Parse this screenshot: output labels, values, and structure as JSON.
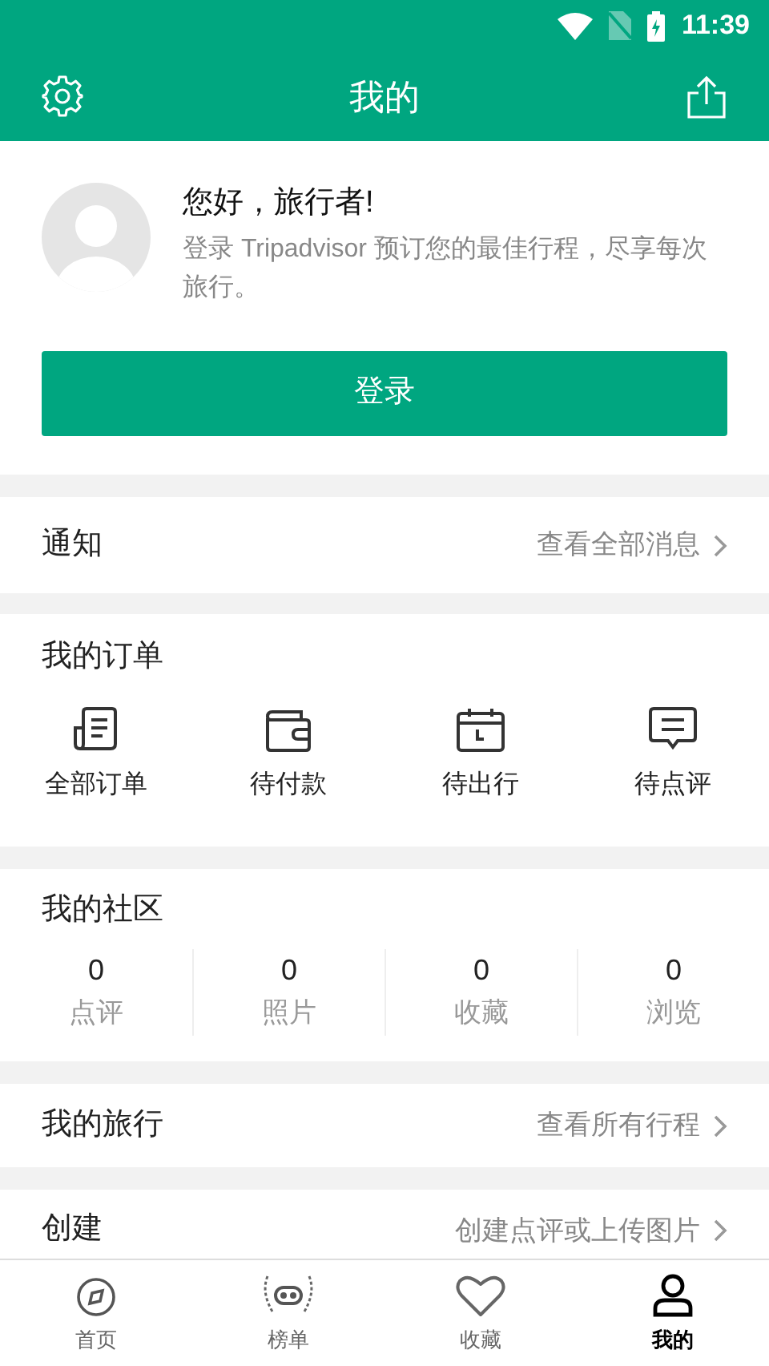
{
  "status_bar": {
    "time": "11:39"
  },
  "header": {
    "title": "我的"
  },
  "profile": {
    "greeting": "您好，旅行者!",
    "subtitle": "登录 Tripadvisor 预订您的最佳行程，尽享每次旅行。",
    "login_button": "登录"
  },
  "notifications": {
    "label": "通知",
    "link": "查看全部消息"
  },
  "orders": {
    "title": "我的订单",
    "items": [
      {
        "kind": "all",
        "label": "全部订单"
      },
      {
        "kind": "payment",
        "label": "待付款"
      },
      {
        "kind": "departure",
        "label": "待出行"
      },
      {
        "kind": "review",
        "label": "待点评"
      }
    ]
  },
  "community": {
    "title": "我的社区",
    "stats": [
      {
        "count": "0",
        "label": "点评"
      },
      {
        "count": "0",
        "label": "照片"
      },
      {
        "count": "0",
        "label": "收藏"
      },
      {
        "count": "0",
        "label": "浏览"
      }
    ]
  },
  "trips": {
    "label": "我的旅行",
    "link": "查看所有行程"
  },
  "create": {
    "label": "创建",
    "link": "创建点评或上传图片"
  },
  "bottom_nav": [
    {
      "kind": "home",
      "label": "首页",
      "selected": false
    },
    {
      "kind": "rankings",
      "label": "榜单",
      "selected": false
    },
    {
      "kind": "saved",
      "label": "收藏",
      "selected": false
    },
    {
      "kind": "me",
      "label": "我的",
      "selected": true
    }
  ]
}
